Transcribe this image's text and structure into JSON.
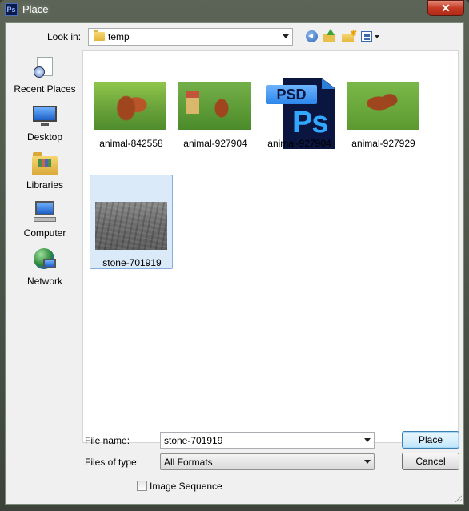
{
  "window": {
    "title": "Place",
    "app_icon": "Ps",
    "close_glyph": "✕"
  },
  "lookin": {
    "label": "Look in:",
    "value": "temp"
  },
  "toolbar": {
    "icons": [
      "back-icon",
      "up-folder-icon",
      "new-folder-icon",
      "view-menu-icon"
    ]
  },
  "places": [
    {
      "label": "Recent Places",
      "icon": "recent-places-icon"
    },
    {
      "label": "Desktop",
      "icon": "desktop-icon"
    },
    {
      "label": "Libraries",
      "icon": "libraries-icon"
    },
    {
      "label": "Computer",
      "icon": "computer-icon"
    },
    {
      "label": "Network",
      "icon": "network-icon"
    }
  ],
  "files": [
    {
      "name": "animal-842558",
      "kind": "image-thumbnail",
      "selected": false
    },
    {
      "name": "animal-927904",
      "kind": "image-thumbnail",
      "selected": false
    },
    {
      "name": "animal-927904",
      "kind": "psd-icon",
      "badge": "PSD",
      "glyph": "Ps",
      "selected": false
    },
    {
      "name": "animal-927929",
      "kind": "image-thumbnail",
      "selected": false
    },
    {
      "name": "stone-701919",
      "kind": "image-thumbnail",
      "selected": true
    }
  ],
  "form": {
    "file_name_label": "File name:",
    "file_name_value": "stone-701919",
    "file_type_label": "Files of type:",
    "file_type_value": "All Formats",
    "place_button": "Place",
    "cancel_button": "Cancel",
    "image_sequence_label": "Image Sequence",
    "image_sequence_checked": false
  },
  "colors": {
    "selection_bg": "#dbeaf9",
    "selection_border": "#84acdd",
    "close_button": "#c53a24"
  }
}
